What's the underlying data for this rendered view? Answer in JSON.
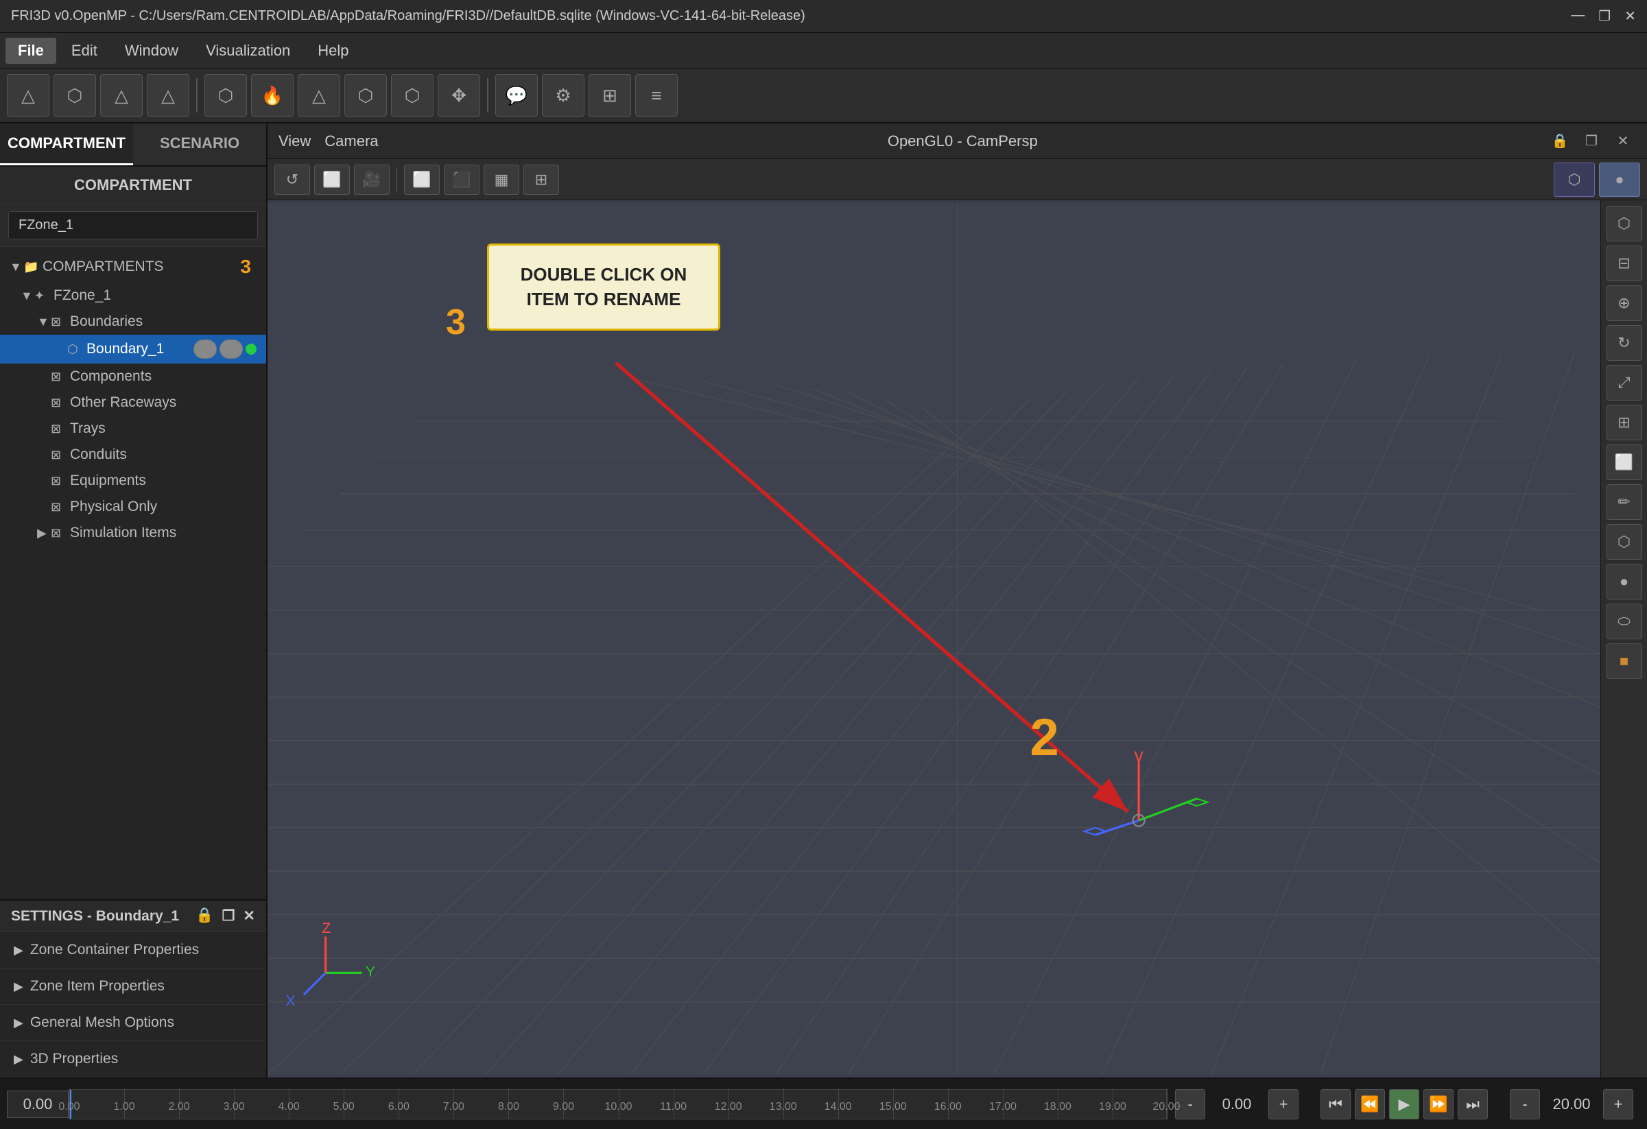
{
  "titlebar": {
    "title": "FRI3D v0.OpenMP - C:/Users/Ram.CENTROIDLAB/AppData/Roaming/FRI3D//DefaultDB.sqlite (Windows-VC-141-64-bit-Release)",
    "minimize": "—",
    "restore": "❐",
    "close": "✕"
  },
  "menubar": {
    "items": [
      "File",
      "Edit",
      "Window",
      "Visualization",
      "Help"
    ]
  },
  "left_panel": {
    "tabs": [
      "COMPARTMENT",
      "SCENARIO"
    ],
    "active_tab": "COMPARTMENT",
    "sub_header": "COMPARTMENT",
    "search_placeholder": "FZone_1",
    "tree": {
      "root": "COMPARTMENTS",
      "badge": "3",
      "items": [
        {
          "label": "FZone_1",
          "level": 1,
          "expanded": true,
          "icon": "zone"
        },
        {
          "label": "Boundaries",
          "level": 2,
          "expanded": true,
          "icon": "cross"
        },
        {
          "label": "Boundary_1",
          "level": 3,
          "selected": true,
          "icon": "box",
          "has_vis": true
        },
        {
          "label": "Components",
          "level": 2,
          "icon": "cross"
        },
        {
          "label": "Other Raceways",
          "level": 2,
          "icon": "cross"
        },
        {
          "label": "Trays",
          "level": 2,
          "icon": "cross"
        },
        {
          "label": "Conduits",
          "level": 2,
          "icon": "cross"
        },
        {
          "label": "Equipments",
          "level": 2,
          "icon": "cross"
        },
        {
          "label": "Physical Only",
          "level": 2,
          "icon": "cross"
        },
        {
          "label": "Simulation Items",
          "level": 2,
          "icon": "cross"
        }
      ]
    }
  },
  "settings_panel": {
    "title": "SETTINGS - Boundary_1",
    "sections": [
      "Zone Container Properties",
      "Zone Item Properties",
      "General Mesh Options",
      "3D Properties"
    ]
  },
  "viewport": {
    "title": "OpenGL0 - CamPersp",
    "view_label": "View",
    "camera_label": "Camera"
  },
  "tooltip": {
    "text": "DOUBLE CLICK ON ITEM TO RENAME"
  },
  "annotations": {
    "num2": "2",
    "num3": "3"
  },
  "timeline": {
    "value": "0.00",
    "start": "0.00",
    "ticks": [
      "0.00",
      "1.00",
      "2.00",
      "3.00",
      "4.00",
      "5.00",
      "6.00",
      "7.00",
      "8.00",
      "9.00",
      "10.00",
      "11.00",
      "12.00",
      "13.00",
      "14.00",
      "15.00",
      "16.00",
      "17.00",
      "18.00",
      "19.00",
      "20.00"
    ],
    "speed_minus": "-",
    "speed_value": "0.00",
    "speed_plus": "+",
    "zoom_minus": "-",
    "zoom_value": "20.00",
    "zoom_plus": "+"
  }
}
